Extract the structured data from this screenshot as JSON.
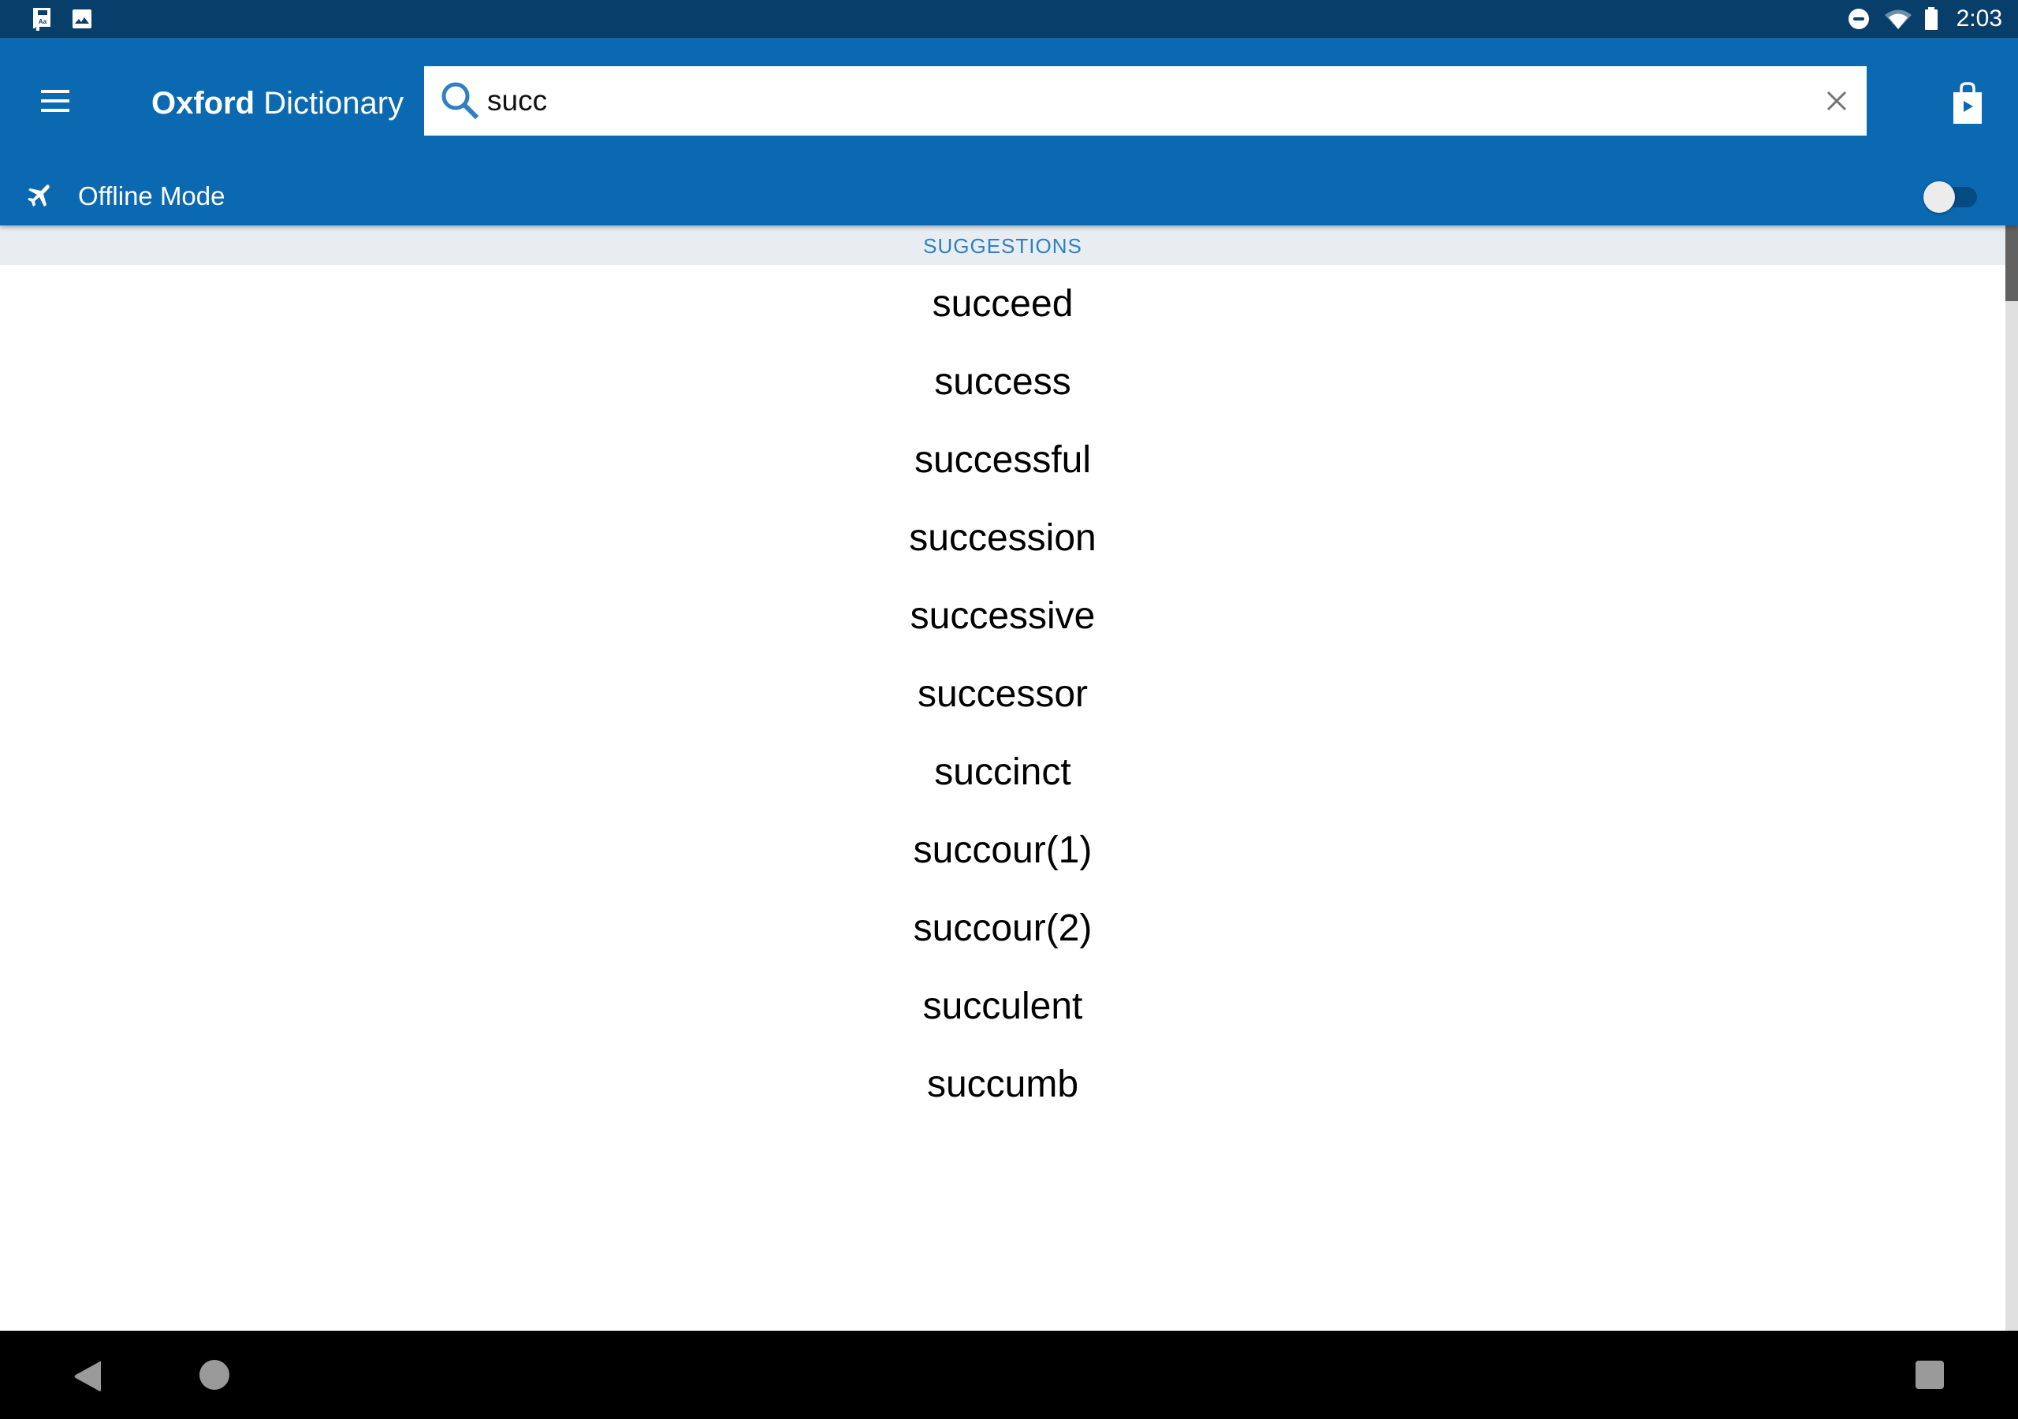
{
  "status_bar": {
    "left_icons": [
      "dictionary-app-icon",
      "image-icon"
    ],
    "right_icons": [
      "do-not-disturb-icon",
      "wifi-icon",
      "battery-icon"
    ],
    "time": "2:03"
  },
  "app_bar": {
    "menu_icon": "hamburger-menu-icon",
    "title_bold": "Oxford",
    "title_regular": " Dictionary",
    "search": {
      "value": "succ",
      "placeholder": "",
      "search_icon": "search-icon",
      "clear_icon": "close-icon"
    },
    "store_icon": "play-store-bag-icon",
    "offline": {
      "icon": "airplane-icon",
      "label": "Offline Mode",
      "toggle_on": false
    }
  },
  "colors": {
    "status_bar": "#083f6a",
    "app_bar": "#0a69b0",
    "accent_text": "#2f7fc1",
    "header_bg": "#e8edf2"
  },
  "suggestions": {
    "header": "SUGGESTIONS",
    "items": [
      "succeed",
      "success",
      "successful",
      "succession",
      "successive",
      "successor",
      "succinct",
      "succour(1)",
      "succour(2)",
      "succulent",
      "succumb"
    ]
  },
  "nav_bar": {
    "buttons": [
      "back-icon",
      "home-icon",
      "recents-icon"
    ]
  }
}
